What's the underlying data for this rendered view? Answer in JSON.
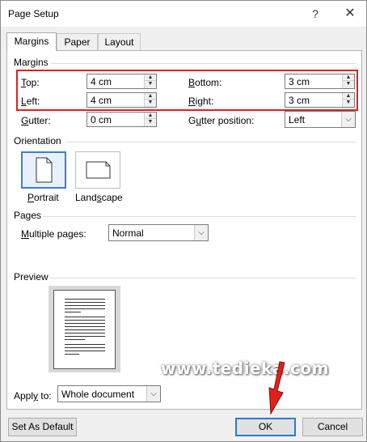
{
  "window": {
    "title": "Page Setup",
    "help": "?",
    "close": "✕"
  },
  "tabs": [
    {
      "label": "Margins"
    },
    {
      "label": "Paper"
    },
    {
      "label": "Layout"
    }
  ],
  "margins": {
    "heading": "Margins",
    "top_label_u": "T",
    "top_label": "op:",
    "top_value": "4 cm",
    "bottom_label_u": "B",
    "bottom_label": "ottom:",
    "bottom_value": "3 cm",
    "left_label_u": "L",
    "left_label": "eft:",
    "left_value": "4 cm",
    "right_label_u": "R",
    "right_label": "ight:",
    "right_value": "3 cm",
    "gutter_label_u": "G",
    "gutter_label": "utter:",
    "gutter_value": "0 cm",
    "gutter_pos_label_pre": "G",
    "gutter_pos_label_u": "u",
    "gutter_pos_label": "tter position:",
    "gutter_pos_value": "Left"
  },
  "orientation": {
    "heading": "Orientation",
    "portrait_u": "P",
    "portrait": "ortrait",
    "landscape_pre": "Land",
    "landscape_u": "s",
    "landscape": "cape"
  },
  "pages": {
    "heading": "Pages",
    "multiple_label_u": "M",
    "multiple_label": "ultiple pages:",
    "multiple_value": "Normal"
  },
  "preview": {
    "heading": "Preview"
  },
  "apply": {
    "label_pre": "Appl",
    "label_u": "y",
    "label": " to:",
    "value": "Whole document"
  },
  "footer": {
    "default_button": "Set As Default",
    "ok_button": "OK",
    "cancel_button": "Cancel"
  },
  "watermark": "www.tedieka.com",
  "colors": {
    "highlight": "#e0201c",
    "accent": "#2a7ad6"
  }
}
